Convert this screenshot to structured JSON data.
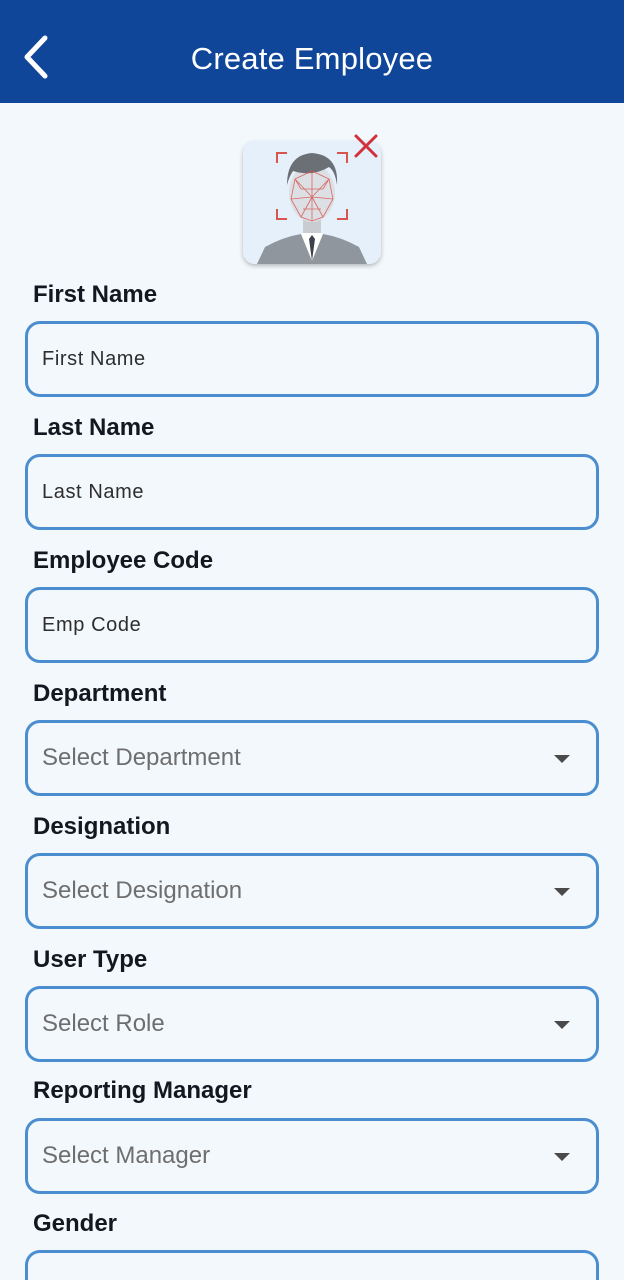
{
  "header": {
    "title": "Create Employee",
    "back_icon": "chevron-left-icon",
    "background": "#0f4699"
  },
  "photo": {
    "placeholder_icon": "face-recognition-avatar-icon",
    "remove_icon": "close-icon"
  },
  "form": {
    "first_name": {
      "label": "First Name",
      "placeholder": "First Name"
    },
    "last_name": {
      "label": "Last Name",
      "placeholder": "Last Name"
    },
    "employee_code": {
      "label": "Employee Code",
      "placeholder": "Emp Code"
    },
    "department": {
      "label": "Department",
      "value": "Select Department"
    },
    "designation": {
      "label": "Designation",
      "value": "Select Designation"
    },
    "user_type": {
      "label": "User Type",
      "value": "Select Role"
    },
    "reporting_manager": {
      "label": "Reporting Manager",
      "value": "Select Manager"
    },
    "gender": {
      "label": "Gender"
    }
  },
  "colors": {
    "field_border": "#4a8ed0",
    "page_background": "#f3f8fc",
    "remove_icon": "#d0313a"
  }
}
